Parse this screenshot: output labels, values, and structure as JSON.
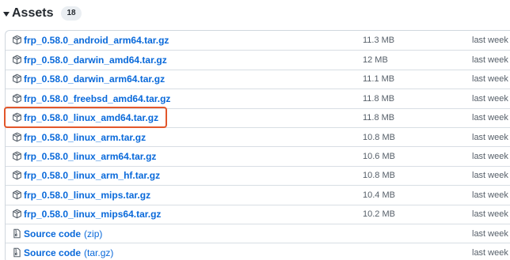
{
  "header": {
    "title": "Assets",
    "count": "18"
  },
  "assets": [
    {
      "name": "frp_0.58.0_android_arm64.tar.gz",
      "suffix": "",
      "size": "11.3 MB",
      "date": "last week",
      "icon": "package-icon"
    },
    {
      "name": "frp_0.58.0_darwin_amd64.tar.gz",
      "suffix": "",
      "size": "12 MB",
      "date": "last week",
      "icon": "package-icon"
    },
    {
      "name": "frp_0.58.0_darwin_arm64.tar.gz",
      "suffix": "",
      "size": "11.1 MB",
      "date": "last week",
      "icon": "package-icon"
    },
    {
      "name": "frp_0.58.0_freebsd_amd64.tar.gz",
      "suffix": "",
      "size": "11.8 MB",
      "date": "last week",
      "icon": "package-icon"
    },
    {
      "name": "frp_0.58.0_linux_amd64.tar.gz",
      "suffix": "",
      "size": "11.8 MB",
      "date": "last week",
      "icon": "package-icon"
    },
    {
      "name": "frp_0.58.0_linux_arm.tar.gz",
      "suffix": "",
      "size": "10.8 MB",
      "date": "last week",
      "icon": "package-icon"
    },
    {
      "name": "frp_0.58.0_linux_arm64.tar.gz",
      "suffix": "",
      "size": "10.6 MB",
      "date": "last week",
      "icon": "package-icon"
    },
    {
      "name": "frp_0.58.0_linux_arm_hf.tar.gz",
      "suffix": "",
      "size": "10.8 MB",
      "date": "last week",
      "icon": "package-icon"
    },
    {
      "name": "frp_0.58.0_linux_mips.tar.gz",
      "suffix": "",
      "size": "10.4 MB",
      "date": "last week",
      "icon": "package-icon"
    },
    {
      "name": "frp_0.58.0_linux_mips64.tar.gz",
      "suffix": "",
      "size": "10.2 MB",
      "date": "last week",
      "icon": "package-icon"
    },
    {
      "name": "Source code",
      "suffix": "(zip)",
      "size": "",
      "date": "last week",
      "icon": "file-zip-icon"
    },
    {
      "name": "Source code",
      "suffix": "(tar.gz)",
      "size": "",
      "date": "last week",
      "icon": "file-zip-icon"
    }
  ],
  "highlight_color": "#e2572b",
  "link_color": "#0969da"
}
